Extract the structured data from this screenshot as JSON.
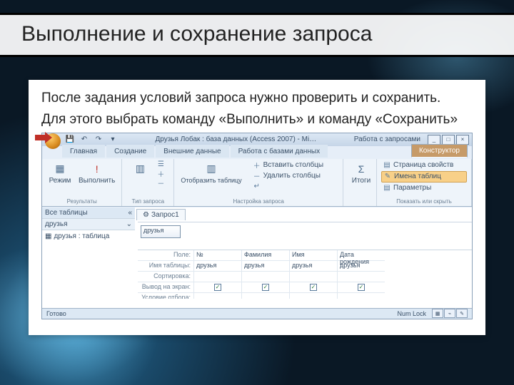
{
  "slide": {
    "title": "Выполнение и сохранение запроса",
    "para1": "После задания условий запроса нужно проверить и сохранить.",
    "para2": "Для этого выбрать команду «Выполнить» и команду «Сохранить»"
  },
  "titlebar": {
    "text": "Друзья Лобак : база данных (Access 2007) - Mi…",
    "context_title": "Работа с запросами",
    "min": "_",
    "max": "□",
    "close": "×"
  },
  "tabs": {
    "home": "Главная",
    "create": "Создание",
    "external": "Внешние данные",
    "dbtools": "Работа с базами данных",
    "design": "Конструктор"
  },
  "ribbon": {
    "results": {
      "view": "Режим",
      "run": "Выполнить",
      "label": "Результаты"
    },
    "querytype": {
      "label": "Тип запроса"
    },
    "setup": {
      "showtable": "Отобразить таблицу",
      "insertcol": "Вставить столбцы",
      "deletecol": "Удалить столбцы",
      "returns_icon": "↵",
      "label": "Настройка запроса"
    },
    "totals": {
      "totals": "Итоги",
      "sigma": "Σ"
    },
    "showhide": {
      "propsheet": "Страница свойств",
      "tablenames": "Имена таблиц",
      "params": "Параметры",
      "label": "Показать или скрыть"
    }
  },
  "nav": {
    "header": "Все таблицы",
    "collapse": "«",
    "group": "друзья",
    "expand_icon": "⌄",
    "item1": "друзья : таблица",
    "item_icon": "▦"
  },
  "doc": {
    "tab_icon": "⚙",
    "tab_label": "Запрос1",
    "table_name": "друзья",
    "close": "×",
    "rowlabels": {
      "field": "Поле:",
      "table": "Имя таблицы:",
      "sort": "Сортировка:",
      "show": "Вывод на экран:",
      "criteria": "Условие отбора:"
    },
    "cols": [
      {
        "field": "№",
        "table": "друзья",
        "checked": true
      },
      {
        "field": "Фамилия",
        "table": "друзья",
        "checked": true
      },
      {
        "field": "Имя",
        "table": "друзья",
        "checked": true
      },
      {
        "field": "Дата рождения",
        "table": "друзья",
        "checked": true
      }
    ]
  },
  "status": {
    "left": "Готово",
    "right": "Num Lock"
  },
  "icons": {
    "save": "💾",
    "undo": "↶",
    "redo": "↷",
    "dd": "▾",
    "grid_view": "▦",
    "excl": "!",
    "table": "▥",
    "select": "☰",
    "plus": "＋",
    "minus": "－",
    "sheet": "▤",
    "pencil": "✎"
  }
}
